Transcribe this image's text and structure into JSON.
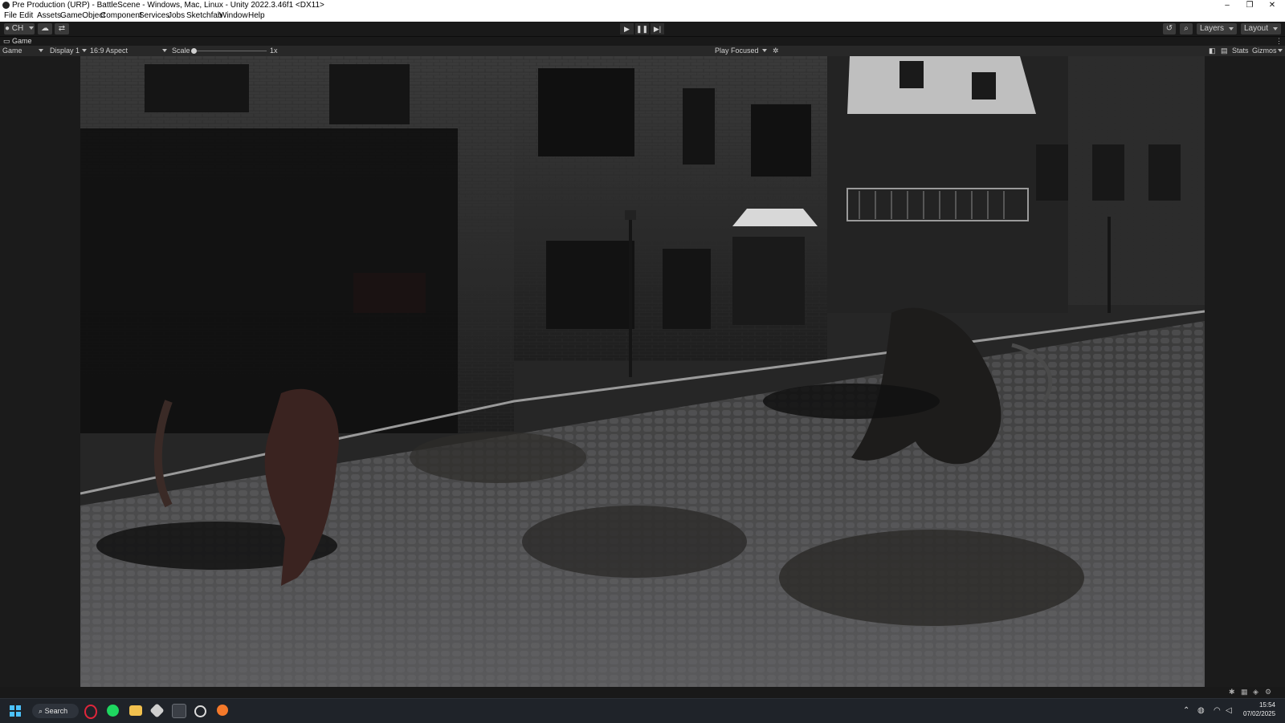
{
  "window": {
    "title": "Pre Production (URP) - BattleScene - Windows, Mac, Linux - Unity 2022.3.46f1 <DX11>",
    "minimize": "–",
    "restore": "❐",
    "close": "✕"
  },
  "menu": [
    "File",
    "Edit",
    "Assets",
    "GameObject",
    "Component",
    "Services",
    "Jobs",
    "Sketchfab",
    "Window",
    "Help"
  ],
  "toolbar": {
    "account_label": "CH",
    "layers_label": "Layers",
    "layout_label": "Layout",
    "play_icon": "play-icon",
    "pause_icon": "pause-icon",
    "step_icon": "step-icon"
  },
  "game_tab": {
    "label": "Game"
  },
  "game_toolbar": {
    "mode": "Game",
    "display": "Display 1",
    "aspect": "16:9 Aspect",
    "scale_label": "Scale",
    "scale_value": "1x",
    "play_mode": "Play Focused",
    "stats_label": "Stats",
    "gizmos_label": "Gizmos"
  },
  "taskbar": {
    "search_label": "Search",
    "time": "15:54",
    "date": "07/02/2025"
  }
}
